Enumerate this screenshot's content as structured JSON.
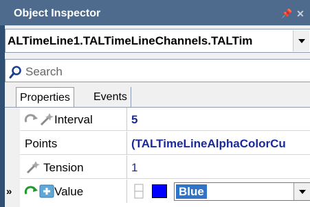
{
  "window": {
    "title": "Object Inspector"
  },
  "object_selector": {
    "value": "ALTimeLine1.TALTimeLineChannels.TALTim"
  },
  "search": {
    "placeholder": "Search"
  },
  "tabs": [
    {
      "label": "Properties",
      "active": true
    },
    {
      "label": "Events",
      "active": false
    }
  ],
  "properties": [
    {
      "name": "Interval",
      "value": "5",
      "icons": [
        "refresh-icon",
        "wand-icon"
      ]
    },
    {
      "name": "Points",
      "value": "(TALTimeLineAlphaColorCu",
      "icons": []
    },
    {
      "name": "Tension",
      "value": "1",
      "icons": [
        "wand-icon"
      ]
    },
    {
      "name": "Value",
      "value": "Blue",
      "icons": [
        "refresh-icon-green",
        "plus-icon"
      ],
      "swatch_color": "#0000ff"
    }
  ],
  "row_marker": "»",
  "colors": {
    "title_bar": "#4e6a8c",
    "value_text": "#1a2a9a",
    "selection": "#3173c6"
  }
}
